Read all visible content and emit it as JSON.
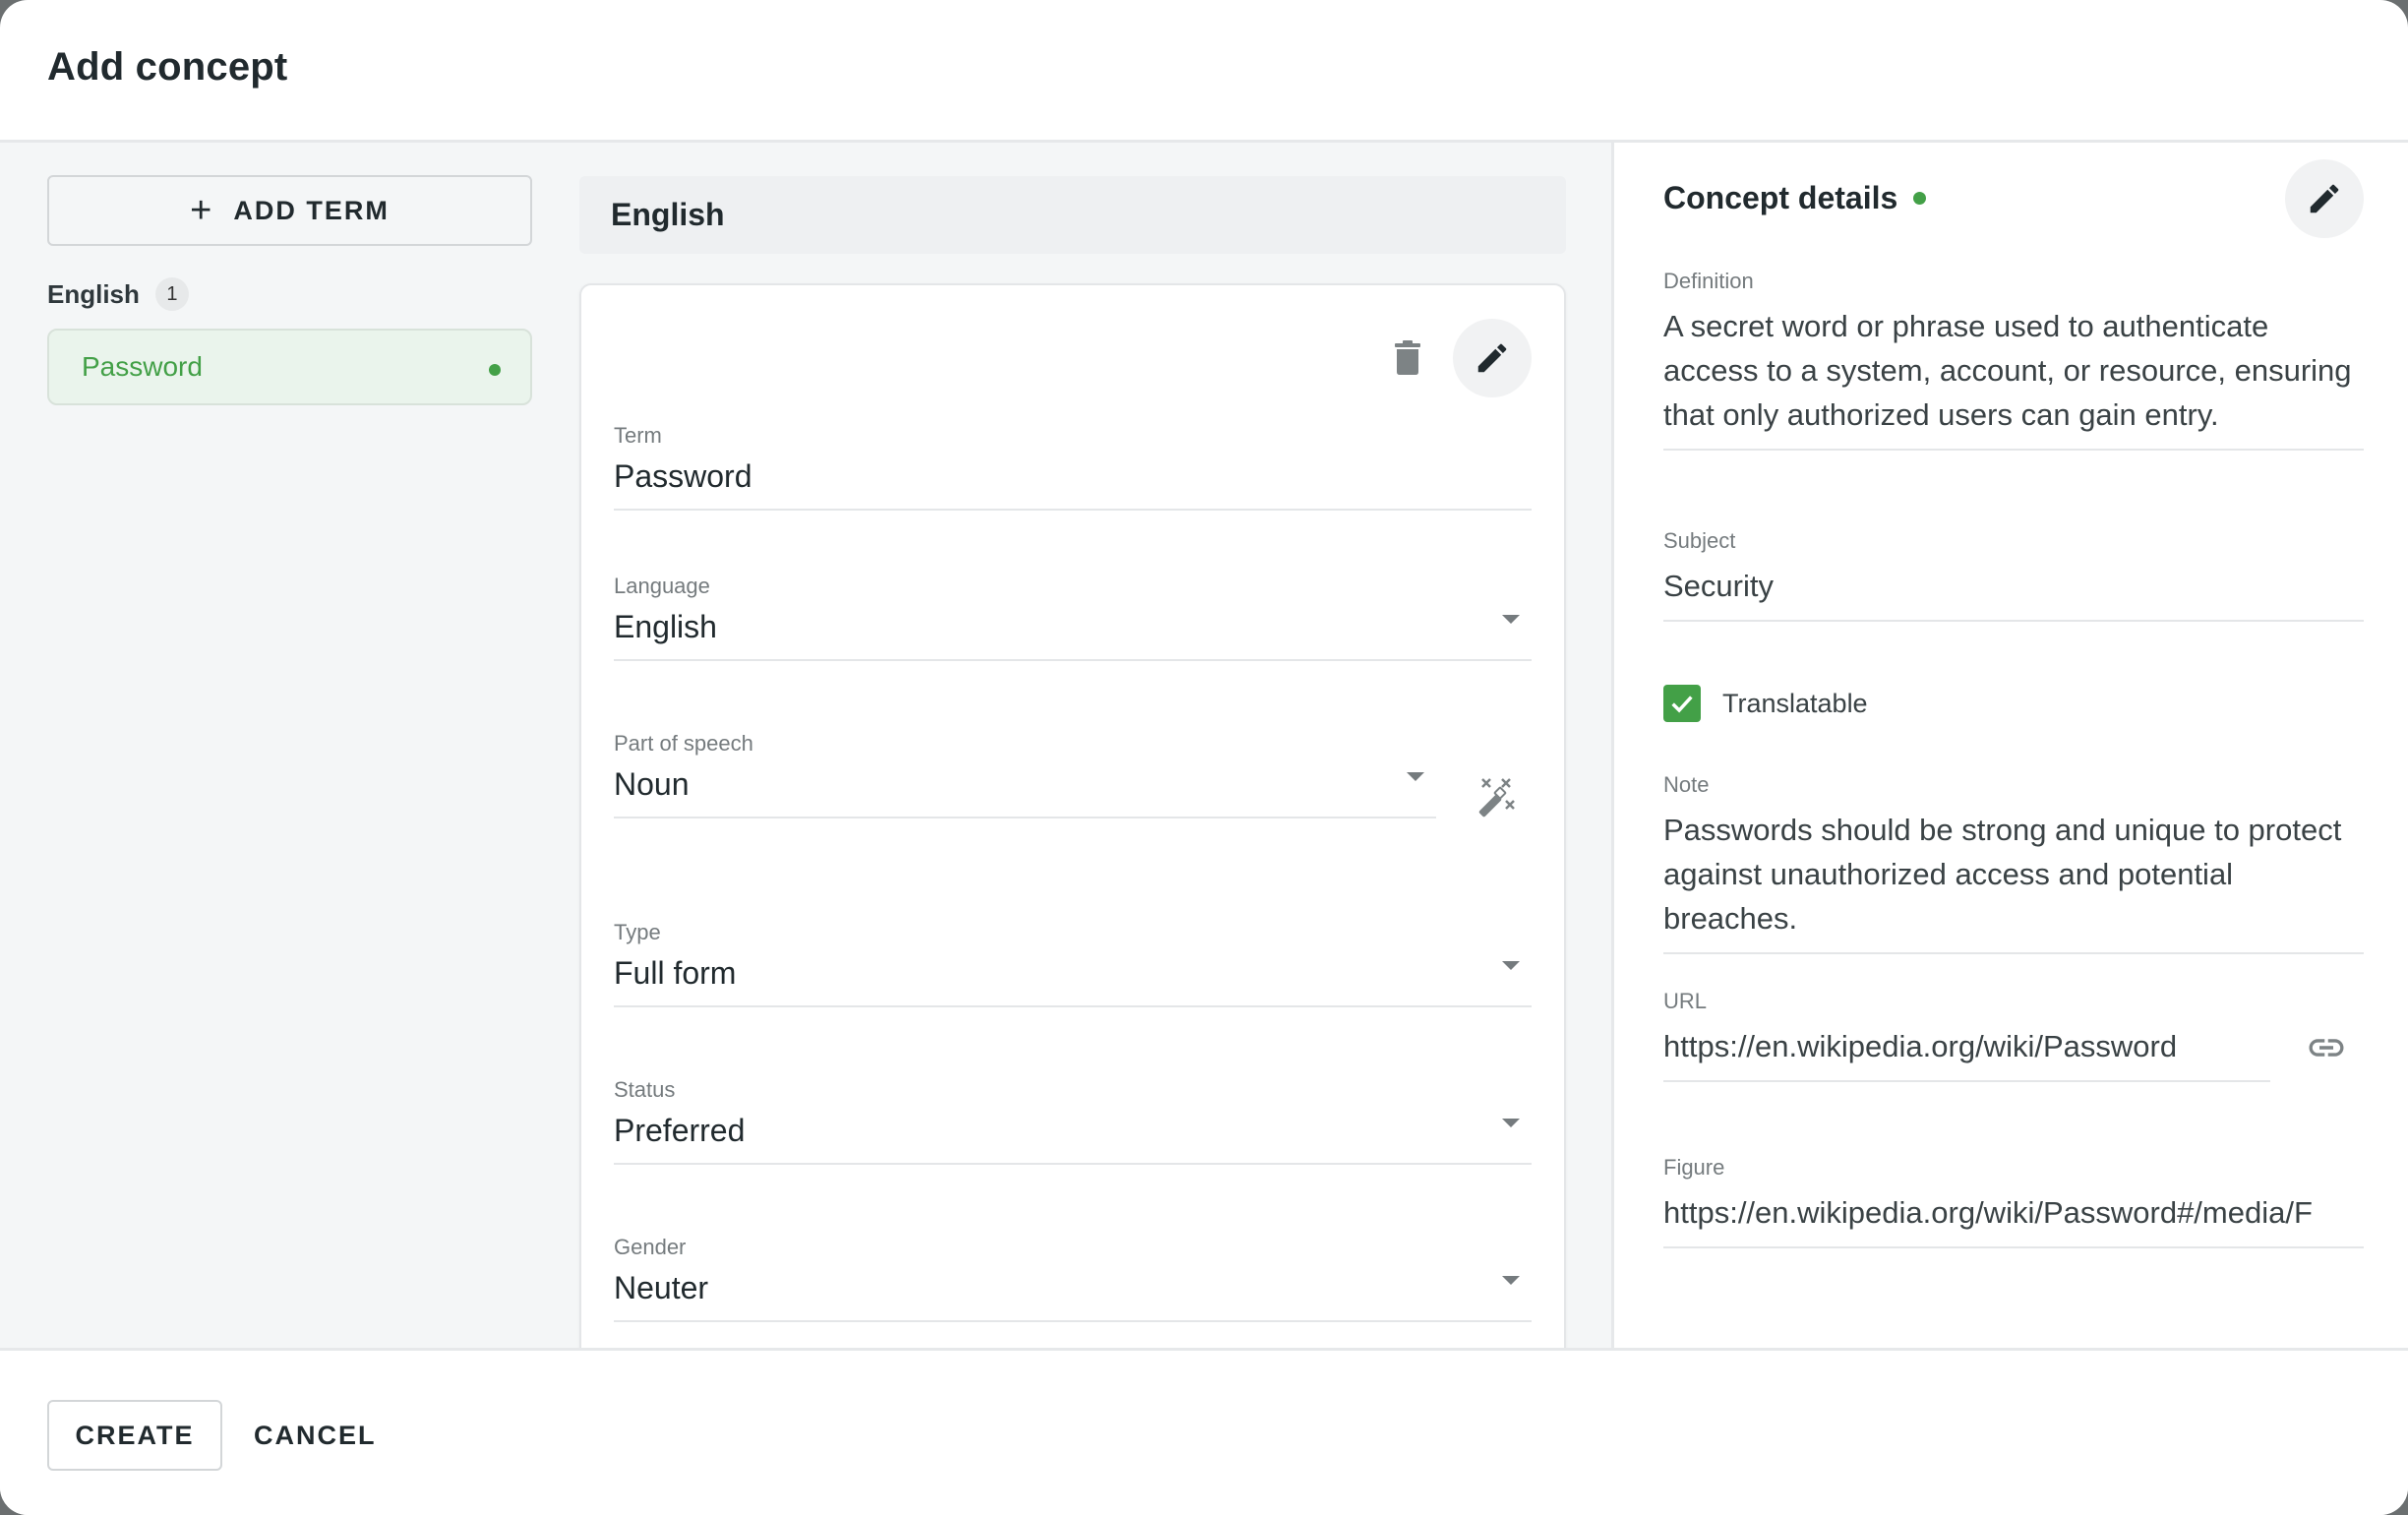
{
  "dialog": {
    "title": "Add concept"
  },
  "left": {
    "add_term_label": "ADD TERM",
    "language_group": {
      "name": "English",
      "count": "1"
    },
    "terms": [
      {
        "label": "Password",
        "status_color": "#43a047"
      }
    ]
  },
  "middle": {
    "language_header": "English",
    "card": {
      "delete_icon": "trash-icon",
      "edit_icon": "pencil-icon",
      "fields": {
        "term": {
          "label": "Term",
          "value": "Password"
        },
        "language": {
          "label": "Language",
          "value": "English"
        },
        "part_of_speech": {
          "label": "Part of speech",
          "value": "Noun",
          "action_icon": "magic-wand-icon"
        },
        "type": {
          "label": "Type",
          "value": "Full form"
        },
        "status": {
          "label": "Status",
          "value": "Preferred"
        },
        "gender": {
          "label": "Gender",
          "value": "Neuter"
        }
      }
    }
  },
  "right": {
    "title": "Concept details",
    "status_color": "#43a047",
    "edit_icon": "pencil-icon",
    "definition": {
      "label": "Definition",
      "value": "A secret word or phrase used to authenticate access to a system, account, or resource, ensuring that only authorized users can gain entry."
    },
    "subject": {
      "label": "Subject",
      "value": "Security"
    },
    "translatable": {
      "label": "Translatable",
      "checked": true
    },
    "note": {
      "label": "Note",
      "value": "Passwords should be strong and unique to protect against unauthorized access and potential breaches."
    },
    "url": {
      "label": "URL",
      "value": "https://en.wikipedia.org/wiki/Password",
      "action_icon": "link-icon"
    },
    "figure": {
      "label": "Figure",
      "value": "https://en.wikipedia.org/wiki/Password#/media/F"
    }
  },
  "footer": {
    "create_label": "CREATE",
    "cancel_label": "CANCEL"
  },
  "colors": {
    "accent_green": "#43a047",
    "text_primary": "#212a2e",
    "text_label": "#757b7e"
  }
}
